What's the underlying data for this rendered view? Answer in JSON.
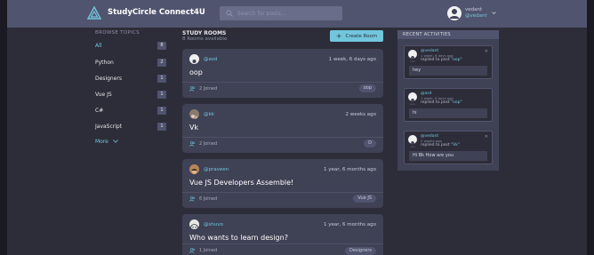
{
  "header": {
    "brand": "StudyCircle Connect4U",
    "search_placeholder": "Search for posts...",
    "user": {
      "name": "vedant",
      "handle": "@vedant"
    }
  },
  "sidebar": {
    "title": "BROWSE TOPICS",
    "topics": [
      {
        "label": "All",
        "count": "8"
      },
      {
        "label": "Python",
        "count": "2"
      },
      {
        "label": "Designers",
        "count": "1"
      },
      {
        "label": "Vue JS",
        "count": "1"
      },
      {
        "label": "C#",
        "count": "1"
      },
      {
        "label": "JavaScript",
        "count": "1"
      }
    ],
    "more": "More"
  },
  "main": {
    "title": "STUDY ROOMS",
    "subtitle": "8 Rooms available",
    "create_label": "Create Room",
    "rooms": [
      {
        "host": "@asd",
        "time": "1 week, 6 days ago",
        "name": "oop",
        "joined": "2 Joined",
        "tag": "oop"
      },
      {
        "host": "@kk",
        "time": "2 weeks ago",
        "name": "Vk",
        "joined": "2 Joined",
        "tag": "D"
      },
      {
        "host": "@praveen",
        "time": "1 year, 6 months ago",
        "name": "Vue JS Developers Assemble!",
        "joined": "6 Joined",
        "tag": "Vue JS"
      },
      {
        "host": "@shuvo",
        "time": "1 year, 6 months ago",
        "name": "Who wants to learn design?",
        "joined": "1 Joined",
        "tag": "Designers"
      }
    ]
  },
  "activities": {
    "title": "RECENT ACTIVITIES",
    "items": [
      {
        "user": "@vedant",
        "time": "1 week, 6 days ago",
        "action": "replied to post",
        "post": "\"oop\"",
        "message": "hey"
      },
      {
        "user": "@asd",
        "time": "1 week, 6 days ago",
        "action": "replied to post",
        "post": "\"oop\"",
        "message": "hi"
      },
      {
        "user": "@vedant",
        "time": "2 weeks ago",
        "action": "replied to post",
        "post": "\"Vk\"",
        "message": "Hi Bk How are you"
      }
    ]
  }
}
